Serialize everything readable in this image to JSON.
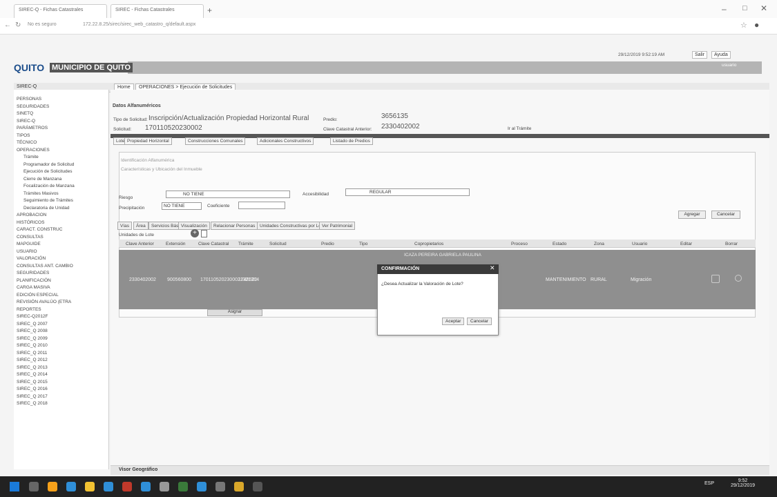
{
  "browser": {
    "tab1": "SIREC-Q - Fichas Catastrales",
    "tab2": "SIREC - Fichas Catastrales",
    "address_secure": "No es seguro",
    "address_url": "172.22.8.25/sirec/sirec_web_catastro_q/default.aspx"
  },
  "header": {
    "datetime": "29/12/2019 9:52:19 AM",
    "salir": "Salir",
    "ayuda": "Ayuda",
    "logo_quito": "QUITO",
    "logo_title": "MUNICIPIO DE QUITO",
    "user": "usuario"
  },
  "sidebar": {
    "root": "SIREC-Q",
    "items": [
      "PERSONAS",
      "SEGURIDADES",
      "SINETQ",
      "SIREC-Q",
      "PARÁMETROS",
      "TIPOS",
      "TÉCNICO",
      "OPERACIONES",
      "Trámite",
      "Programador de Solicitud",
      "Ejecución de Solicitudes",
      "Cierre de Manzana",
      "Focalización de Manzana",
      "Trámites Masivos",
      "Seguimiento de Trámites",
      "Declaratoria de Unidad",
      "APROBACION",
      "HISTÓRICOS",
      "CARACT. CONSTRUC",
      "CONSULTAS",
      "MAPGUIDE",
      "USUARIO",
      "VALORACIÓN",
      "CONSULTAS ANT. CAMBIO",
      "SEGURIDADES",
      "PLANIFICACIÓN",
      "CARGA MASIVA",
      "EDICIÓN ESPECIAL",
      "REVISIÓN AVALÚO (ETRA",
      "REPORTES",
      "SIREC-Q2012F",
      "SIREC_Q 2007",
      "SIREC_Q 2008",
      "SIREC_Q 2009",
      "SIREC_Q 2010",
      "SIREC_Q 2011",
      "SIREC_Q 2012",
      "SIREC_Q 2013",
      "SIREC_Q 2014",
      "SIREC_Q 2015",
      "SIREC_Q 2016",
      "SIREC_Q 2017",
      "SIREC_Q 2018"
    ]
  },
  "breadcrumb": {
    "home": "Home",
    "path": "OPERACIONES > Ejecución de Solicitudes"
  },
  "section": {
    "title": "Datos Alfanuméricos",
    "viewer": "Visor Geográfico"
  },
  "form": {
    "tipo_label": "Tipo de Solicitud:",
    "tipo_value": "Inscripción/Actualización Propiedad Horizontal Rural",
    "predio_label": "Predio:",
    "predio_value": "3656135",
    "sol_label": "Solicitud:",
    "sol_value": "170110520230002",
    "clave_label": "Clave Catastral Anterior:",
    "clave_value": "2330402002",
    "ir_tramite": "Ir al Trámite"
  },
  "tabs": [
    "Lote",
    "Propiedad Horizontal",
    "Construcciones Comunales",
    "Adicionales Constructivos",
    "Listado de Predios"
  ],
  "lote": {
    "ident": "Identificación Alfanumérica",
    "info": "Características y Ubicación del Inmueble",
    "riesgo_label": "Riesgo",
    "riesgo_value": "NO TIENE",
    "acc_label": "Accesibilidad",
    "acc_value": "REGULAR",
    "precip_label": "Precipitación",
    "precip_value": "NO TIENE",
    "coef_label": "Coeficiente"
  },
  "subtabs": [
    "Vías",
    "Área",
    "Servicios Básicos",
    "Visualización",
    "Relacionar Personas",
    "Unidades Constructivas por Lote",
    "Ver Patrimonial"
  ],
  "actions": {
    "agregar": "Agregar",
    "cancelar": "Cancelar",
    "unidades": "Unidades de Lote",
    "asignar": "Asignar"
  },
  "table": {
    "headers": [
      "Clave Anterior",
      "Extensión",
      "Clave Catastral",
      "Trámite",
      "Solicitud",
      "Predio",
      "Tipo",
      "Copropietarios",
      "Proceso",
      "Estado",
      "Zona",
      "Usuario",
      "Editar",
      "Borrar"
    ],
    "row": [
      "2330402002",
      "900560800",
      "1701105202300021321314",
      "1748520",
      "",
      "",
      "",
      "",
      "MANTENIMIENTO",
      "RURAL",
      "Migración",
      "",
      ""
    ],
    "owner": "ICAZA PEREIRA GABRIELA PAULINA"
  },
  "dialog": {
    "title": "CONFIRMACIÓN",
    "message": "¿Desea Actualizar la Valoración de Lote?",
    "accept": "Aceptar",
    "cancel": "Cancelar"
  },
  "taskbar": {
    "time": "9:52",
    "date": "29/12/2019",
    "lang": "ESP"
  }
}
